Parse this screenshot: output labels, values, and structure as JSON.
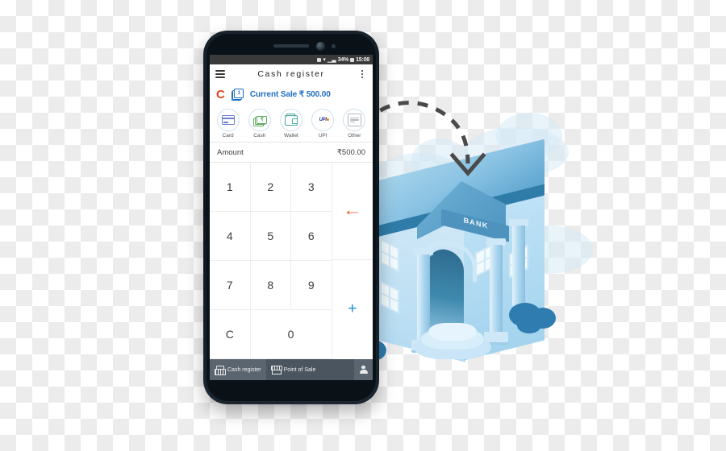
{
  "phone": {
    "status_bar": {
      "battery": "34%",
      "time": "15:08",
      "icons": [
        "alarm-icon",
        "wifi-icon",
        "signal-icon",
        "battery-icon"
      ]
    },
    "app_bar": {
      "menu_icon": "hamburger-menu-icon",
      "title": "Cash register",
      "overflow_icon": "kebab-menu-icon"
    },
    "sale_row": {
      "letter": "C",
      "badge_count": "1",
      "text": "Current Sale ₹ 500.00",
      "accent_orange": "#e8441f",
      "accent_blue": "#1f6fc4"
    },
    "payment_methods": [
      {
        "label": "Card",
        "icon": "credit-card-icon",
        "color": "#6b7fd0"
      },
      {
        "label": "Cash",
        "icon": "banknotes-icon",
        "color": "#5aab5e"
      },
      {
        "label": "Wallet",
        "icon": "wallet-icon",
        "color": "#4aa8a0"
      },
      {
        "label": "UPI",
        "icon": "upi-logo-icon",
        "color": "#2a3f8f"
      },
      {
        "label": "Other",
        "icon": "document-icon",
        "color": "#b8b8b8"
      }
    ],
    "amount": {
      "label": "Amount",
      "value": "₹500.00"
    },
    "keypad": {
      "keys": [
        "1",
        "2",
        "3",
        "4",
        "5",
        "6",
        "7",
        "8",
        "9",
        "C",
        "0"
      ],
      "backspace": "←",
      "backspace_name": "backspace-key",
      "backspace_color": "#f1511b",
      "plus": "+",
      "plus_name": "plus-key",
      "plus_color": "#1f8ccf"
    },
    "bottom_nav": [
      {
        "label": "Cash register",
        "icon": "cash-register-icon",
        "active": true
      },
      {
        "label": "Point of Sale",
        "icon": "storefront-icon",
        "active": false
      },
      {
        "label": "",
        "icon": "person-icon",
        "active": false
      }
    ]
  },
  "illustration": {
    "bank_sign": "BANK",
    "bank_name": "bank-building-illustration",
    "arrow_name": "dashed-transfer-arrow",
    "arrow_color": "#4a4a4a",
    "roof_color": "#2f7ca8",
    "wall_color": "#cfe8f7",
    "bush_color": "#2f7cb0"
  }
}
